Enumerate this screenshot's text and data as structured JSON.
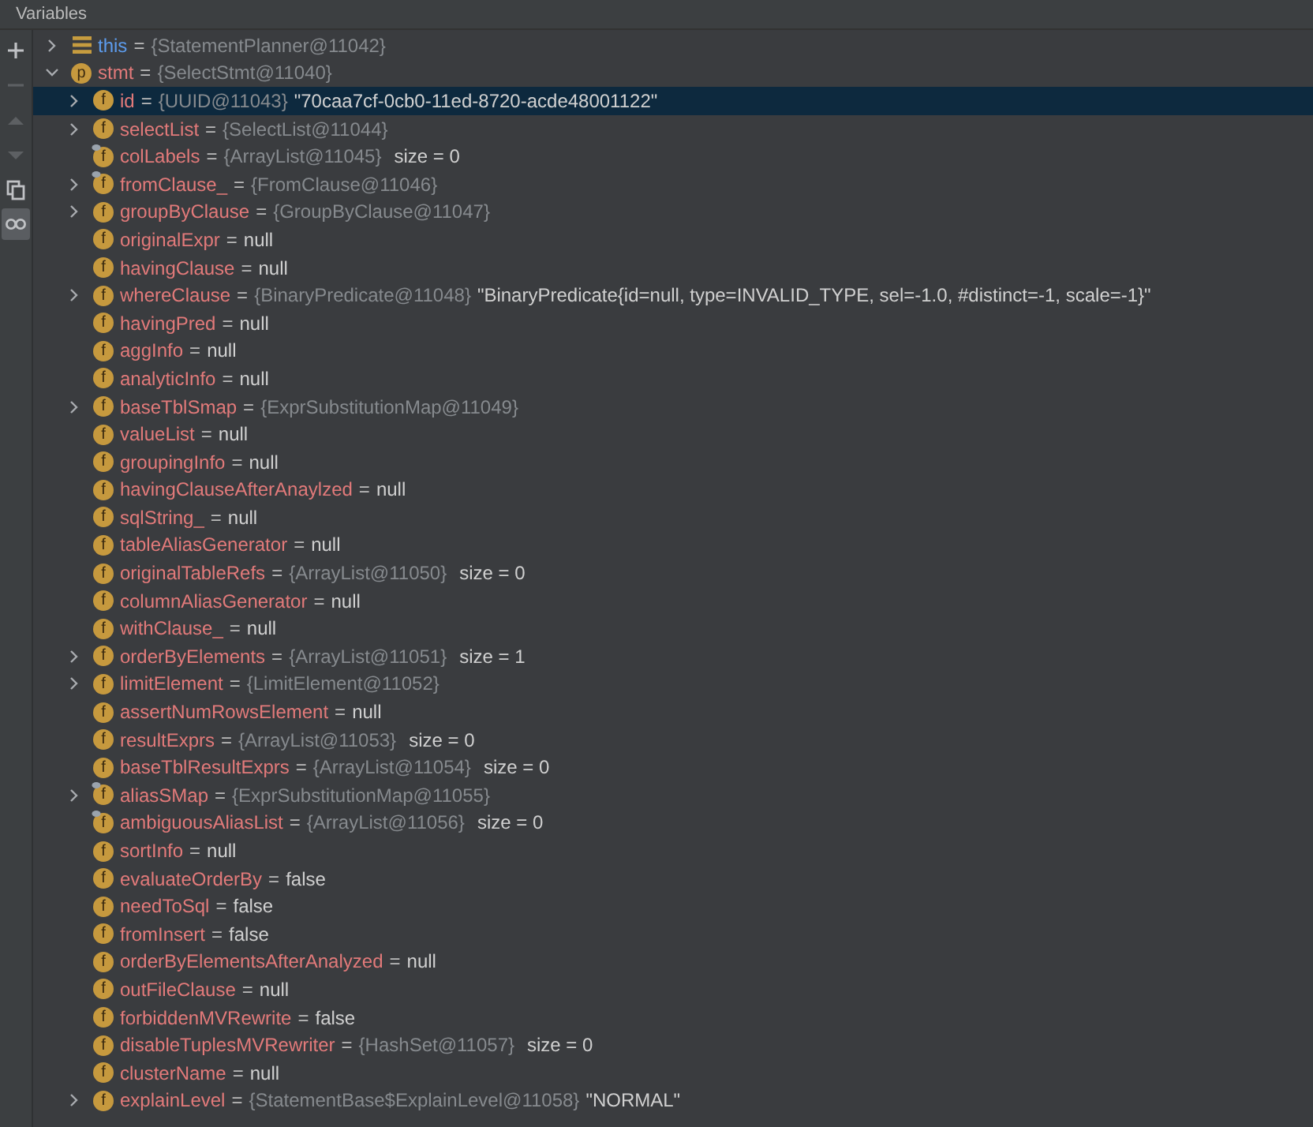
{
  "panel": {
    "title": "Variables"
  },
  "toolbar": [
    {
      "kind": "plus",
      "disabled": false,
      "selected": false
    },
    {
      "kind": "minus",
      "disabled": true,
      "selected": false
    },
    {
      "kind": "up",
      "disabled": true,
      "selected": false
    },
    {
      "kind": "down",
      "disabled": true,
      "selected": false
    },
    {
      "kind": "copy",
      "disabled": false,
      "selected": false
    },
    {
      "kind": "glasses",
      "disabled": false,
      "selected": true
    }
  ],
  "tree": [
    {
      "kind": "this",
      "name": "this",
      "sep": "=",
      "type": "{StatementPlanner@11042}",
      "expanded": false,
      "selected": false,
      "marked": false
    },
    {
      "kind": "param",
      "letter": "p",
      "name": "stmt",
      "sep": "=",
      "type": "{SelectStmt@11040}",
      "expanded": true,
      "selected": false,
      "marked": false,
      "children": [
        {
          "kind": "field",
          "letter": "f",
          "name": "id",
          "sep": "=",
          "type": "{UUID@11043}",
          "value": "\"70caa7cf-0cb0-11ed-8720-acde48001122\"",
          "expanded": false,
          "selected": true,
          "marked": false
        },
        {
          "kind": "field",
          "letter": "f",
          "name": "selectList",
          "sep": "=",
          "type": "{SelectList@11044}",
          "expanded": false,
          "selected": false,
          "marked": false
        },
        {
          "kind": "field",
          "letter": "f",
          "name": "colLabels",
          "sep": "=",
          "type": "{ArrayList@11045}",
          "size": "size = 0",
          "selected": false,
          "marked": true
        },
        {
          "kind": "field",
          "letter": "f",
          "name": "fromClause_",
          "sep": "=",
          "type": "{FromClause@11046}",
          "expanded": false,
          "selected": false,
          "marked": true
        },
        {
          "kind": "field",
          "letter": "f",
          "name": "groupByClause",
          "sep": "=",
          "type": "{GroupByClause@11047}",
          "expanded": false,
          "selected": false,
          "marked": false
        },
        {
          "kind": "field",
          "letter": "f",
          "name": "originalExpr",
          "sep": "=",
          "value": "null",
          "selected": false,
          "marked": false
        },
        {
          "kind": "field",
          "letter": "f",
          "name": "havingClause",
          "sep": "=",
          "value": "null",
          "selected": false,
          "marked": false
        },
        {
          "kind": "field",
          "letter": "f",
          "name": "whereClause",
          "sep": "=",
          "type": "{BinaryPredicate@11048}",
          "value": "\"BinaryPredicate{id=null, type=INVALID_TYPE, sel=-1.0, #distinct=-1, scale=-1}\"",
          "expanded": false,
          "selected": false,
          "marked": false
        },
        {
          "kind": "field",
          "letter": "f",
          "name": "havingPred",
          "sep": "=",
          "value": "null",
          "selected": false,
          "marked": false
        },
        {
          "kind": "field",
          "letter": "f",
          "name": "aggInfo",
          "sep": "=",
          "value": "null",
          "selected": false,
          "marked": false
        },
        {
          "kind": "field",
          "letter": "f",
          "name": "analyticInfo",
          "sep": "=",
          "value": "null",
          "selected": false,
          "marked": false
        },
        {
          "kind": "field",
          "letter": "f",
          "name": "baseTblSmap",
          "sep": "=",
          "type": "{ExprSubstitutionMap@11049}",
          "expanded": false,
          "selected": false,
          "marked": false
        },
        {
          "kind": "field",
          "letter": "f",
          "name": "valueList",
          "sep": "=",
          "value": "null",
          "selected": false,
          "marked": false
        },
        {
          "kind": "field",
          "letter": "f",
          "name": "groupingInfo",
          "sep": "=",
          "value": "null",
          "selected": false,
          "marked": false
        },
        {
          "kind": "field",
          "letter": "f",
          "name": "havingClauseAfterAnaylzed",
          "sep": "=",
          "value": "null",
          "selected": false,
          "marked": false
        },
        {
          "kind": "field",
          "letter": "f",
          "name": "sqlString_",
          "sep": "=",
          "value": "null",
          "selected": false,
          "marked": false
        },
        {
          "kind": "field",
          "letter": "f",
          "name": "tableAliasGenerator",
          "sep": "=",
          "value": "null",
          "selected": false,
          "marked": false
        },
        {
          "kind": "field",
          "letter": "f",
          "name": "originalTableRefs",
          "sep": "=",
          "type": "{ArrayList@11050}",
          "size": "size = 0",
          "selected": false,
          "marked": false
        },
        {
          "kind": "field",
          "letter": "f",
          "name": "columnAliasGenerator",
          "sep": "=",
          "value": "null",
          "selected": false,
          "marked": false
        },
        {
          "kind": "field",
          "letter": "f",
          "name": "withClause_",
          "sep": "=",
          "value": "null",
          "selected": false,
          "marked": false
        },
        {
          "kind": "field",
          "letter": "f",
          "name": "orderByElements",
          "sep": "=",
          "type": "{ArrayList@11051}",
          "size": "size = 1",
          "expanded": false,
          "selected": false,
          "marked": false
        },
        {
          "kind": "field",
          "letter": "f",
          "name": "limitElement",
          "sep": "=",
          "type": "{LimitElement@11052}",
          "expanded": false,
          "selected": false,
          "marked": false
        },
        {
          "kind": "field",
          "letter": "f",
          "name": "assertNumRowsElement",
          "sep": "=",
          "value": "null",
          "selected": false,
          "marked": false
        },
        {
          "kind": "field",
          "letter": "f",
          "name": "resultExprs",
          "sep": "=",
          "type": "{ArrayList@11053}",
          "size": "size = 0",
          "selected": false,
          "marked": false
        },
        {
          "kind": "field",
          "letter": "f",
          "name": "baseTblResultExprs",
          "sep": "=",
          "type": "{ArrayList@11054}",
          "size": "size = 0",
          "selected": false,
          "marked": false
        },
        {
          "kind": "field",
          "letter": "f",
          "name": "aliasSMap",
          "sep": "=",
          "type": "{ExprSubstitutionMap@11055}",
          "expanded": false,
          "selected": false,
          "marked": true
        },
        {
          "kind": "field",
          "letter": "f",
          "name": "ambiguousAliasList",
          "sep": "=",
          "type": "{ArrayList@11056}",
          "size": "size = 0",
          "selected": false,
          "marked": true
        },
        {
          "kind": "field",
          "letter": "f",
          "name": "sortInfo",
          "sep": "=",
          "value": "null",
          "selected": false,
          "marked": false
        },
        {
          "kind": "field",
          "letter": "f",
          "name": "evaluateOrderBy",
          "sep": "=",
          "value": "false",
          "selected": false,
          "marked": false
        },
        {
          "kind": "field",
          "letter": "f",
          "name": "needToSql",
          "sep": "=",
          "value": "false",
          "selected": false,
          "marked": false
        },
        {
          "kind": "field",
          "letter": "f",
          "name": "fromInsert",
          "sep": "=",
          "value": "false",
          "selected": false,
          "marked": false
        },
        {
          "kind": "field",
          "letter": "f",
          "name": "orderByElementsAfterAnalyzed",
          "sep": "=",
          "value": "null",
          "selected": false,
          "marked": false
        },
        {
          "kind": "field",
          "letter": "f",
          "name": "outFileClause",
          "sep": "=",
          "value": "null",
          "selected": false,
          "marked": false
        },
        {
          "kind": "field",
          "letter": "f",
          "name": "forbiddenMVRewrite",
          "sep": "=",
          "value": "false",
          "selected": false,
          "marked": false
        },
        {
          "kind": "field",
          "letter": "f",
          "name": "disableTuplesMVRewriter",
          "sep": "=",
          "type": "{HashSet@11057}",
          "size": "size = 0",
          "selected": false,
          "marked": false
        },
        {
          "kind": "field",
          "letter": "f",
          "name": "clusterName",
          "sep": "=",
          "value": "null",
          "selected": false,
          "marked": false
        },
        {
          "kind": "field",
          "letter": "f",
          "name": "explainLevel",
          "sep": "=",
          "type": "{StatementBase$ExplainLevel@11058}",
          "value": "\"NORMAL\"",
          "expanded": false,
          "selected": false,
          "marked": false
        }
      ]
    }
  ]
}
